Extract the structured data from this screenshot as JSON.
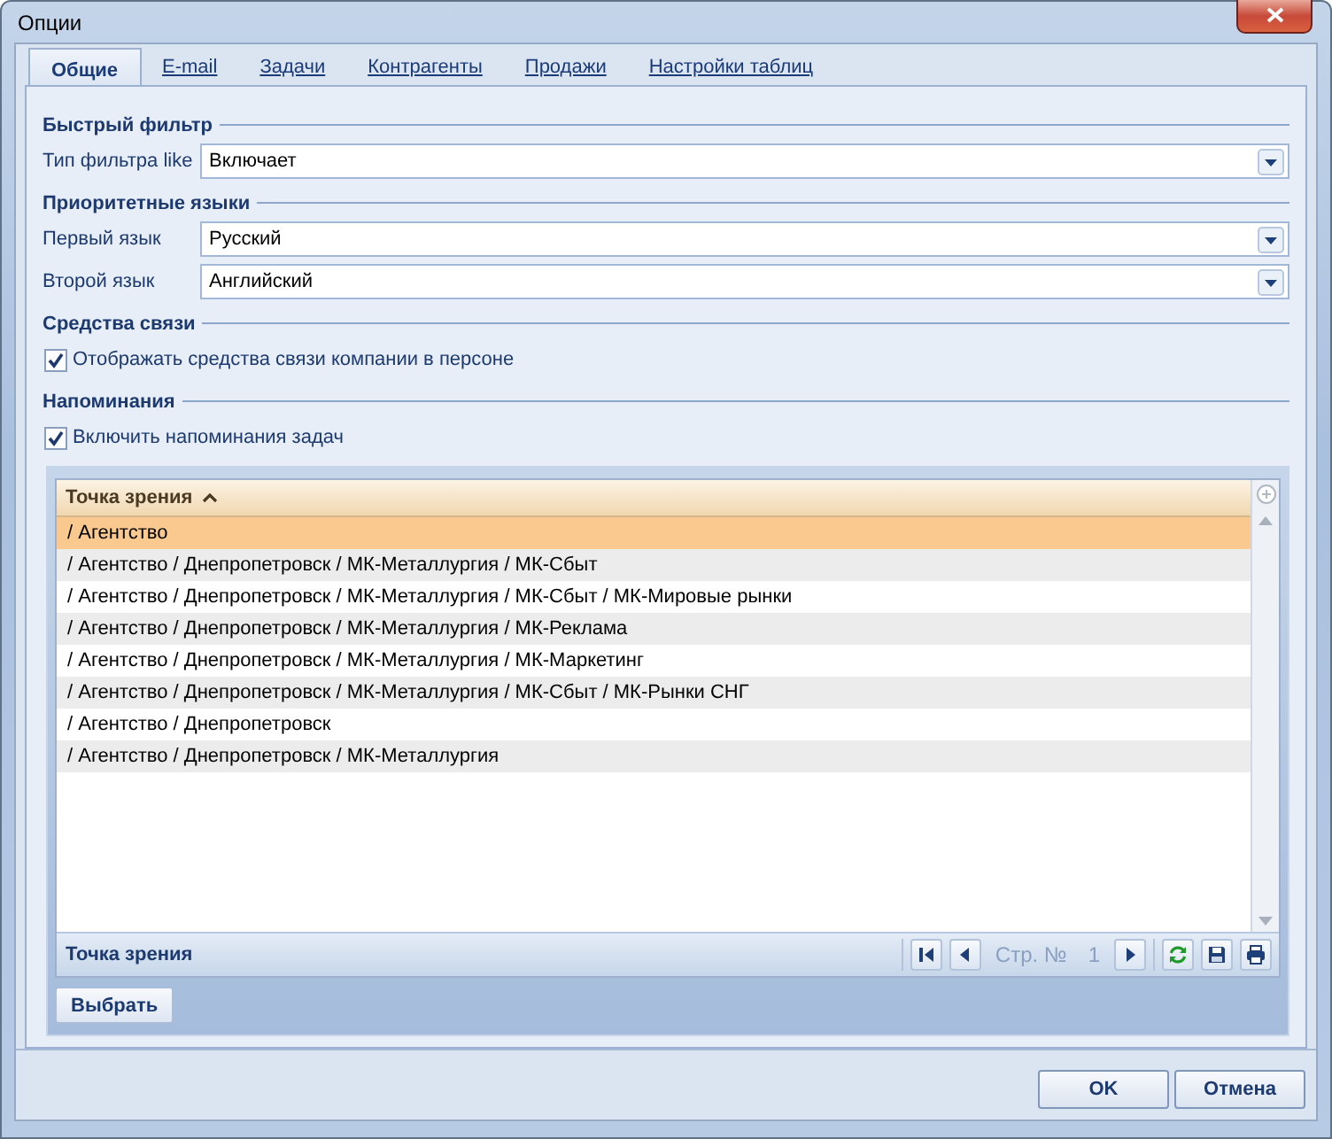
{
  "window": {
    "title": "Опции"
  },
  "tabs": [
    {
      "label": "Общие",
      "selected": true
    },
    {
      "label": "E-mail",
      "selected": false
    },
    {
      "label": "Задачи",
      "selected": false
    },
    {
      "label": "Контрагенты",
      "selected": false
    },
    {
      "label": "Продажи",
      "selected": false
    },
    {
      "label": "Настройки таблиц",
      "selected": false
    }
  ],
  "sections": [
    {
      "title": "Быстрый фильтр",
      "kind": "fields",
      "fields": [
        {
          "label": "Тип фильтра like",
          "value": "Включает"
        }
      ]
    },
    {
      "title": "Приоритетные языки",
      "kind": "fields",
      "fields": [
        {
          "label": "Первый язык",
          "value": "Русский"
        },
        {
          "label": "Второй язык",
          "value": "Английский"
        }
      ]
    },
    {
      "title": "Средства связи",
      "kind": "check",
      "checkbox": {
        "label": "Отображать средства связи компании в персоне",
        "checked": true
      }
    },
    {
      "title": "Напоминания",
      "kind": "check",
      "checkbox": {
        "label": "Включить напоминания задач",
        "checked": true
      }
    }
  ],
  "grid": {
    "column": "Точка зрения",
    "rows": [
      {
        "text": "/ Агентство",
        "selected": true
      },
      {
        "text": "/ Агентство / Днепропетровск / МК-Металлургия / МК-Сбыт",
        "selected": false
      },
      {
        "text": "/ Агентство / Днепропетровск / МК-Металлургия / МК-Сбыт / МК-Мировые рынки",
        "selected": false
      },
      {
        "text": "/ Агентство / Днепропетровск / МК-Металлургия / МК-Реклама",
        "selected": false
      },
      {
        "text": "/ Агентство / Днепропетровск / МК-Металлургия / МК-Маркетинг",
        "selected": false
      },
      {
        "text": "/ Агентство / Днепропетровск / МК-Металлургия / МК-Сбыт / МК-Рынки СНГ",
        "selected": false
      },
      {
        "text": "/ Агентство / Днепропетровск",
        "selected": false
      },
      {
        "text": "/ Агентство / Днепропетровск / МК-Металлургия",
        "selected": false
      }
    ],
    "footer": {
      "title": "Точка зрения",
      "page_label": "Стр. №",
      "page": "1"
    }
  },
  "select_button": "Выбрать",
  "buttons": [
    "OK",
    "Отмена"
  ]
}
